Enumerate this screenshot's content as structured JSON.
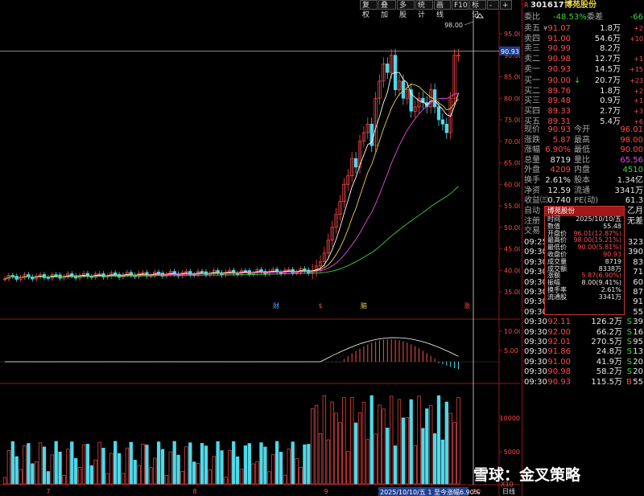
{
  "toolbar": {
    "buttons": [
      "复权",
      "叠加",
      "多股",
      "统计",
      "画线",
      "F10",
      "标记",
      "-",
      "+"
    ]
  },
  "chart": {
    "last_price_tag": "90.93",
    "high_marker": "98.00",
    "price_ticks": [
      "95.00",
      "90.00",
      "85.00",
      "80.00",
      "75.00",
      "70.00",
      "65.00",
      "60.00",
      "55.00",
      "50.00",
      "45.00",
      "40.00",
      "35.00"
    ],
    "event_markers": [
      {
        "label": "财",
        "color": "#4fb0ff"
      },
      {
        "label": "$",
        "color": "#ff4b4b"
      },
      {
        "label": "脑",
        "color": "#e8d24a"
      },
      {
        "label": "涨",
        "color": "#ff4b4b"
      }
    ],
    "macd_ticks": [
      "10.00",
      "5.00"
    ],
    "vol_ticks": [
      "10000",
      "5000"
    ],
    "x_labels": [
      "7",
      "8",
      "9",
      "10"
    ],
    "bottom_status": "2025/10/10/五 1 至今涨幅6.90%",
    "bottom_right": "日线",
    "vol_unit": "X10"
  },
  "panel": {
    "code_prefix": "R",
    "code": "301617",
    "name": "博苑股份",
    "weibi_label": "委比",
    "weibi_value": "-48.53%",
    "weicha_label": "委差",
    "weicha_value": "-66",
    "sells": [
      {
        "label": "卖五",
        "flag": "¥",
        "price": "91.07",
        "vol": "1.8万",
        "chg": "+2"
      },
      {
        "label": "卖四",
        "flag": "",
        "price": "91.00",
        "vol": "54.6万",
        "chg": "+10"
      },
      {
        "label": "卖三",
        "flag": "",
        "price": "90.99",
        "vol": "8.2万",
        "chg": ""
      },
      {
        "label": "卖二",
        "flag": "",
        "price": "90.98",
        "vol": "12.7万",
        "chg": "+1"
      },
      {
        "label": "卖一",
        "flag": "",
        "price": "90.93",
        "vol": "14.5万",
        "chg": "+15"
      }
    ],
    "buys": [
      {
        "label": "买一",
        "flag": "",
        "price": "90.00",
        "vol": "20.7万",
        "chg": "+23"
      },
      {
        "label": "买二",
        "flag": "",
        "price": "89.76",
        "vol": "1.8万",
        "chg": "+2"
      },
      {
        "label": "买三",
        "flag": "",
        "price": "89.48",
        "vol": "0.9万",
        "chg": "+1"
      },
      {
        "label": "买四",
        "flag": "",
        "price": "89.33",
        "vol": "2.7万",
        "chg": "+3"
      },
      {
        "label": "买五",
        "flag": "",
        "price": "89.31",
        "vol": "5.4万",
        "chg": "+6"
      }
    ],
    "buy_arrow": "↓",
    "quotes": [
      {
        "l1": "现价",
        "v1": "90.93",
        "c1": "red",
        "l2": "今开",
        "v2": "96.01",
        "c2": "red"
      },
      {
        "l1": "涨跌",
        "v1": "5.87",
        "c1": "red",
        "l2": "最高",
        "v2": "98.00",
        "c2": "red"
      },
      {
        "l1": "涨幅",
        "v1": "6.90%",
        "c1": "red",
        "l2": "最低",
        "v2": "90.00",
        "c2": "red"
      },
      {
        "l1": "总量",
        "v1": "8719",
        "c1": "white",
        "l2": "量比",
        "v2": "65.56",
        "c2": "pink"
      },
      {
        "l1": "外盘",
        "v1": "4209",
        "c1": "red",
        "l2": "内盘",
        "v2": "4510",
        "c2": "green"
      },
      {
        "l1": "换手",
        "v1": "2.61%",
        "c1": "white",
        "l2": "股本",
        "v2": "1.34亿",
        "c2": "white"
      },
      {
        "l1": "净资",
        "v1": "12.59",
        "c1": "white",
        "l2": "流通",
        "v2": "3341万",
        "c2": "white"
      },
      {
        "l1": "收益㈢",
        "v1": "0.740",
        "c1": "white",
        "l2": "PE(动)",
        "v2": "61.3",
        "c2": "white"
      }
    ],
    "misc_rows": [
      "自动",
      "注册",
      "交易"
    ],
    "misc_right": [
      "乙月",
      "无差"
    ],
    "ticks": [
      {
        "time": "09:25",
        "price": "",
        "vol": "",
        "flag": "",
        "n": "323"
      },
      {
        "time": "09:30",
        "price": "",
        "vol": "",
        "flag": "",
        "n": "390"
      },
      {
        "time": "09:30",
        "price": "",
        "vol": "",
        "flag": "",
        "n": "83"
      },
      {
        "time": "09:30",
        "price": "",
        "vol": "",
        "flag": "",
        "n": "71"
      },
      {
        "time": "09:30",
        "price": "",
        "vol": "",
        "flag": "",
        "n": "60"
      },
      {
        "time": "09:30",
        "price": "",
        "vol": "",
        "flag": "",
        "n": "87"
      },
      {
        "time": "09:30",
        "price": "",
        "vol": "",
        "flag": "",
        "n": "91"
      },
      {
        "time": "09:30",
        "price": "",
        "vol": "",
        "flag": "",
        "n": "55"
      },
      {
        "time": "09:30",
        "price": "92.11",
        "vol": "126.2万",
        "flag": "S",
        "n": "39"
      },
      {
        "time": "09:30",
        "price": "92.00",
        "vol": "66.2万",
        "flag": "S",
        "n": "16"
      },
      {
        "time": "09:30",
        "price": "92.01",
        "vol": "270.5万",
        "flag": "S",
        "n": "95"
      },
      {
        "time": "09:30",
        "price": "91.86",
        "vol": "24.8万",
        "flag": "S",
        "n": "13"
      },
      {
        "time": "09:30",
        "price": "91.00",
        "vol": "41.9万",
        "flag": "S",
        "n": "20"
      },
      {
        "time": "09:30",
        "price": "90.98",
        "vol": "58.2万",
        "flag": "S",
        "n": "20"
      },
      {
        "time": "09:30",
        "price": "90.93",
        "vol": "115.5万",
        "flag": "B",
        "n": "55"
      }
    ]
  },
  "popup": {
    "title": "博苑股份",
    "rows": [
      {
        "k": "时间",
        "v": "2025/10/10/五",
        "c": "white"
      },
      {
        "k": "数值",
        "v": "55.48",
        "c": "white"
      },
      {
        "k": "开盘价",
        "v": "96.01(12.87%)",
        "c": "red"
      },
      {
        "k": "最高价",
        "v": "98.00(15.21%)",
        "c": "red"
      },
      {
        "k": "最低价",
        "v": "90.00(5.81%)",
        "c": "red"
      },
      {
        "k": "收盘价",
        "v": "90.93",
        "c": "red"
      },
      {
        "k": "成交量",
        "v": "8719",
        "c": "white"
      },
      {
        "k": "成交额",
        "v": "8338万",
        "c": "white"
      },
      {
        "k": "涨额",
        "v": "5.87(6.90%)",
        "c": "red"
      },
      {
        "k": "振幅",
        "v": "8.00(9.41%)",
        "c": "white"
      },
      {
        "k": "换手率",
        "v": "2.61%",
        "c": "white"
      },
      {
        "k": "流通股",
        "v": "3341万",
        "c": "white"
      }
    ]
  },
  "watermark": "雪球：金叉策略",
  "colors": {
    "up": "#ff4b4b",
    "down": "#4fd8e8",
    "ma5": "#ffffff",
    "ma10": "#e8d24a",
    "ma20": "#e64be6",
    "ma60": "#3cd63c",
    "border": "#8b1a1a"
  }
}
